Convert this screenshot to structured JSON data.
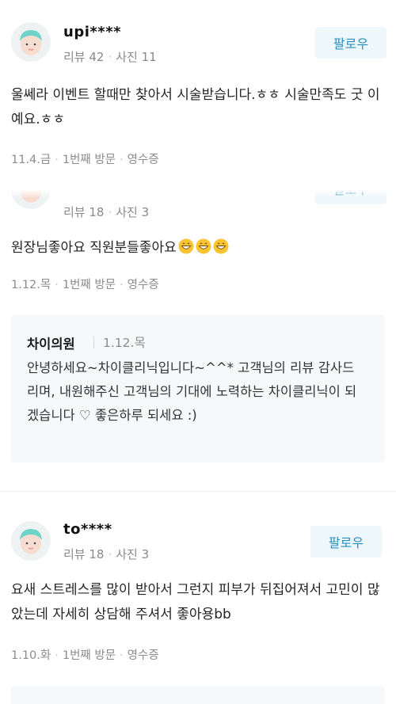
{
  "reviews": [
    {
      "nickname": "upi****",
      "review_count_label": "리뷰 42",
      "photo_count_label": "사진 11",
      "follow_label": "팔로우",
      "text": "울쎄라 이벤트 할때만 찾아서 시술받습니다.ㅎㅎ 시술만족도 굿 이예요.ㅎㅎ",
      "visit_date": "11.4.금",
      "visit_count": "1번째 방문",
      "verification": "영수증"
    },
    {
      "nickname": "",
      "review_count_label": "리뷰 18",
      "photo_count_label": "사진 3",
      "follow_label": "팔로우",
      "text": "원장님좋아요 직원분들좋아요",
      "emoji": [
        "grinning-face",
        "grinning-face",
        "grinning-face"
      ],
      "visit_date": "1.12.목",
      "visit_count": "1번째 방문",
      "verification": "영수증",
      "owner_reply": {
        "owner": "차이의원",
        "date": "1.12.목",
        "text": "안녕하세요~차이클리닉입니다~^^* 고객님의 리뷰 감사드리며, 내원해주신 고객님의 기대에 노력하는 차이클리닉이 되겠습니다 ♡ 좋은하루 되세요 :)"
      }
    },
    {
      "nickname": "to****",
      "review_count_label": "리뷰 18",
      "photo_count_label": "사진 3",
      "follow_label": "팔로우",
      "text": "요새 스트레스를 많이 받아서 그런지 피부가 뒤집어져서 고민이 많았는데 자세히 상담해 주셔서 좋아용bb",
      "visit_date": "1.10.화",
      "visit_count": "1번째 방문",
      "verification": "영수증"
    }
  ],
  "colors": {
    "accent": "#2a8fbf",
    "follow_bg": "#eef7fb",
    "avatar_face": "#f7dcd0",
    "avatar_hair": "#6ed3c9",
    "reply_bg": "#f6f8fa"
  }
}
